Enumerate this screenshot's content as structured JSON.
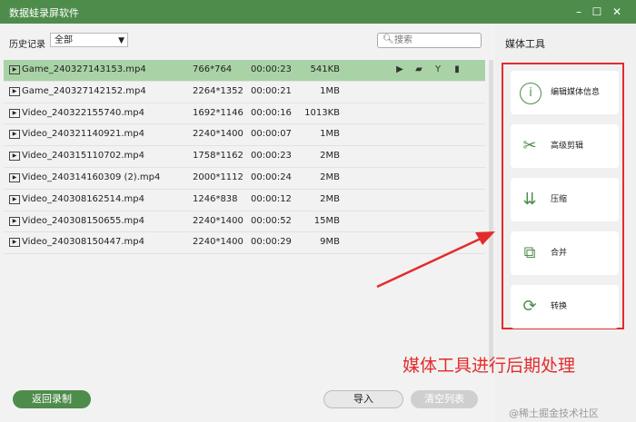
{
  "window": {
    "title": "数据蛙录屏软件"
  },
  "toolbar": {
    "history_label": "历史记录",
    "filter_value": "全部",
    "search_placeholder": "搜索"
  },
  "files": [
    {
      "name": "Game_240327143153.mp4",
      "resolution": "766*764",
      "duration": "00:00:23",
      "size": "541KB"
    },
    {
      "name": "Game_240327142152.mp4",
      "resolution": "2264*1352",
      "duration": "00:00:21",
      "size": "1MB"
    },
    {
      "name": "Video_240322155740.mp4",
      "resolution": "1692*1146",
      "duration": "00:00:16",
      "size": "1013KB"
    },
    {
      "name": "Video_240321140921.mp4",
      "resolution": "2240*1400",
      "duration": "00:00:07",
      "size": "1MB"
    },
    {
      "name": "Video_240315110702.mp4",
      "resolution": "1758*1162",
      "duration": "00:00:23",
      "size": "2MB"
    },
    {
      "name": "Video_240314160309 (2).mp4",
      "resolution": "2000*1112",
      "duration": "00:00:24",
      "size": "2MB"
    },
    {
      "name": "Video_240308162514.mp4",
      "resolution": "1246*838",
      "duration": "00:00:12",
      "size": "2MB"
    },
    {
      "name": "Video_240308150655.mp4",
      "resolution": "2240*1400",
      "duration": "00:00:52",
      "size": "15MB"
    },
    {
      "name": "Video_240308150447.mp4",
      "resolution": "2240*1400",
      "duration": "00:00:29",
      "size": "9MB"
    }
  ],
  "row_actions": [
    "play-icon",
    "folder-icon",
    "edit-tool-icon",
    "trash-icon"
  ],
  "footer": {
    "back_label": "返回录制",
    "import_label": "导入",
    "clear_label": "清空列表"
  },
  "side": {
    "title": "媒体工具",
    "tools": [
      {
        "label": "编辑媒体信息",
        "icon": "info-icon"
      },
      {
        "label": "高级剪辑",
        "icon": "scissors-icon"
      },
      {
        "label": "压缩",
        "icon": "compress-icon"
      },
      {
        "label": "合并",
        "icon": "merge-icon"
      },
      {
        "label": "转换",
        "icon": "convert-icon"
      }
    ]
  },
  "annotation": "媒体工具进行后期处理",
  "watermark": "@稀土掘金技术社区",
  "colors": {
    "accent": "#4e8c4b",
    "selected_row": "#a9d3a6",
    "annotation_red": "#e42b2b"
  }
}
